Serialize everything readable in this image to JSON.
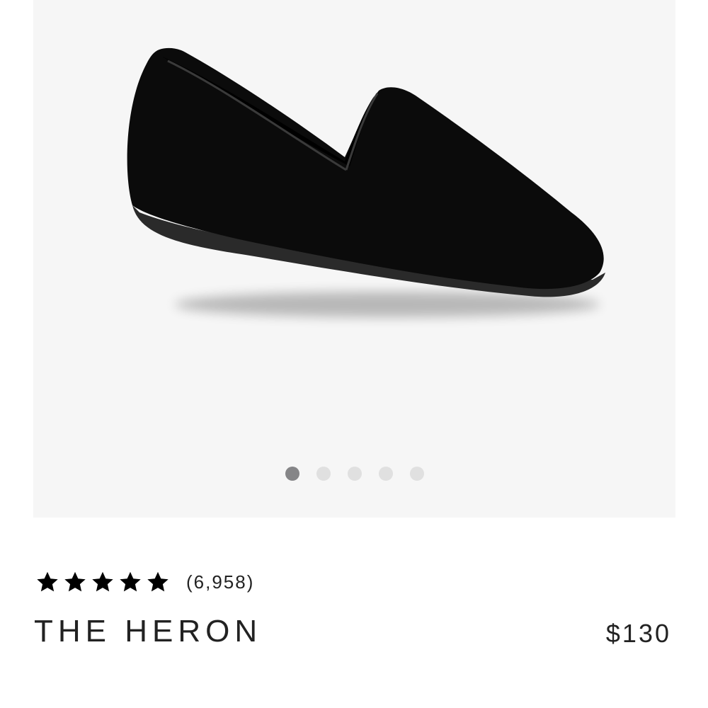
{
  "gallery": {
    "image_alt": "Black suede loafer",
    "dots": [
      {
        "active": true
      },
      {
        "active": false
      },
      {
        "active": false
      },
      {
        "active": false
      },
      {
        "active": false
      }
    ],
    "background": "#f6f6f6"
  },
  "product": {
    "rating": 5,
    "max_rating": 5,
    "star_icon": "star-icon",
    "review_count": "(6,958)",
    "name": "THE HERON",
    "price": "$130"
  },
  "colors": {
    "text": "#222222",
    "dot_active": "#858587",
    "dot_inactive": "#e0e0e0"
  }
}
